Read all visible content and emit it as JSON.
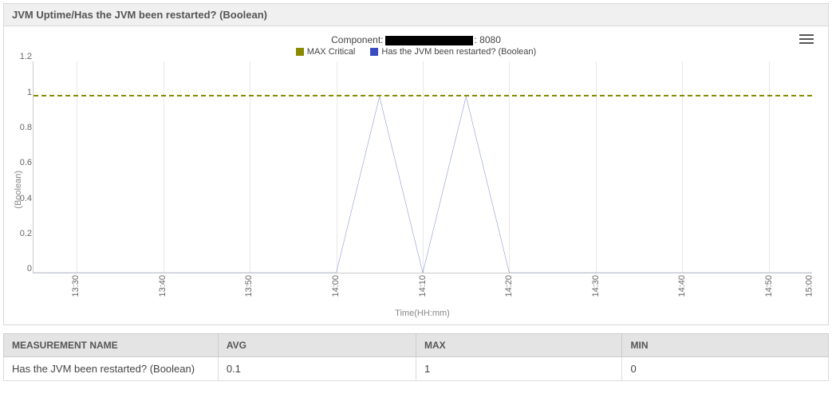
{
  "panel": {
    "title": "JVM Uptime/Has the JVM been restarted? (Boolean)"
  },
  "chart": {
    "title_prefix": "Component:",
    "title_suffix": ": 8080",
    "legend": {
      "series1": {
        "label": "MAX Critical",
        "color": "#8a8a00"
      },
      "series2": {
        "label": "Has the JVM been restarted? (Boolean)",
        "color": "#3b4cc0"
      }
    },
    "ylabel": "(Boolean)",
    "xlabel": "Time(HH:mm)",
    "yticks": [
      "0",
      "0.2",
      "0.4",
      "0.6",
      "0.8",
      "1",
      "1.2"
    ],
    "xticks": [
      "13:30",
      "13:40",
      "13:50",
      "14:00",
      "14:10",
      "14:20",
      "14:30",
      "14:40",
      "14:50",
      "15:00"
    ]
  },
  "table": {
    "headers": {
      "name": "MEASUREMENT NAME",
      "avg": "AVG",
      "max": "MAX",
      "min": "MIN"
    },
    "rows": [
      {
        "name": "Has the JVM been restarted? (Boolean)",
        "avg": "0.1",
        "max": "1",
        "min": "0"
      }
    ]
  },
  "chart_data": {
    "type": "line",
    "title": "Component: [redacted] : 8080",
    "xlabel": "Time(HH:mm)",
    "ylabel": "(Boolean)",
    "ylim": [
      0,
      1.2
    ],
    "x": [
      "13:30",
      "13:35",
      "13:40",
      "13:45",
      "13:50",
      "13:55",
      "14:00",
      "14:05",
      "14:10",
      "14:15",
      "14:20",
      "14:25",
      "14:30",
      "14:35",
      "14:40",
      "14:45",
      "14:50",
      "14:55",
      "15:00"
    ],
    "series": [
      {
        "name": "MAX Critical",
        "values": [
          1,
          1,
          1,
          1,
          1,
          1,
          1,
          1,
          1,
          1,
          1,
          1,
          1,
          1,
          1,
          1,
          1,
          1,
          1
        ],
        "style": "dashed",
        "color": "#8a8a00"
      },
      {
        "name": "Has the JVM been restarted? (Boolean)",
        "values": [
          0,
          0,
          0,
          0,
          0,
          0,
          0,
          1,
          0,
          1,
          0,
          0,
          0,
          0,
          0,
          0,
          0,
          0,
          0
        ],
        "style": "solid",
        "color": "#3b4cc0"
      }
    ]
  }
}
